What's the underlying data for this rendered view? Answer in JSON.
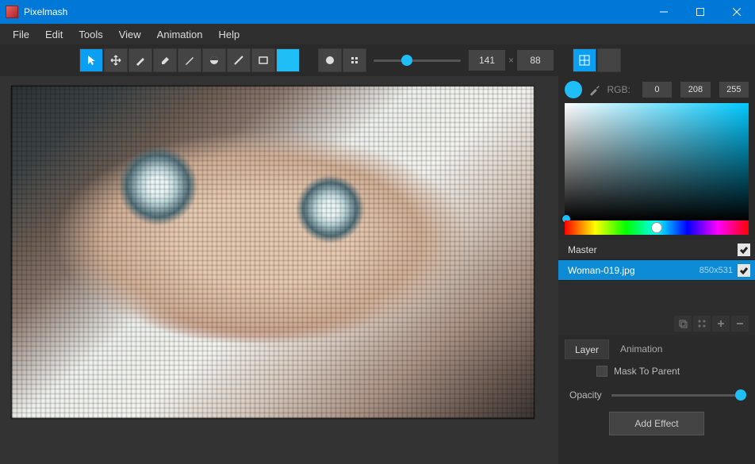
{
  "app": {
    "title": "Pixelmash"
  },
  "menu": [
    "File",
    "Edit",
    "Tools",
    "View",
    "Animation",
    "Help"
  ],
  "toolbar": {
    "size": {
      "w": "141",
      "h": "88"
    }
  },
  "color": {
    "rgb_label": "RGB:",
    "r": "0",
    "g": "208",
    "b": "255",
    "swatch": "#20bef6"
  },
  "layers": {
    "master": "Master",
    "items": [
      {
        "name": "Woman-019.jpg",
        "meta": "850x531"
      }
    ]
  },
  "props": {
    "tabs": [
      "Layer",
      "Animation"
    ],
    "mask_label": "Mask To Parent",
    "opacity_label": "Opacity",
    "add_effect": "Add Effect"
  }
}
